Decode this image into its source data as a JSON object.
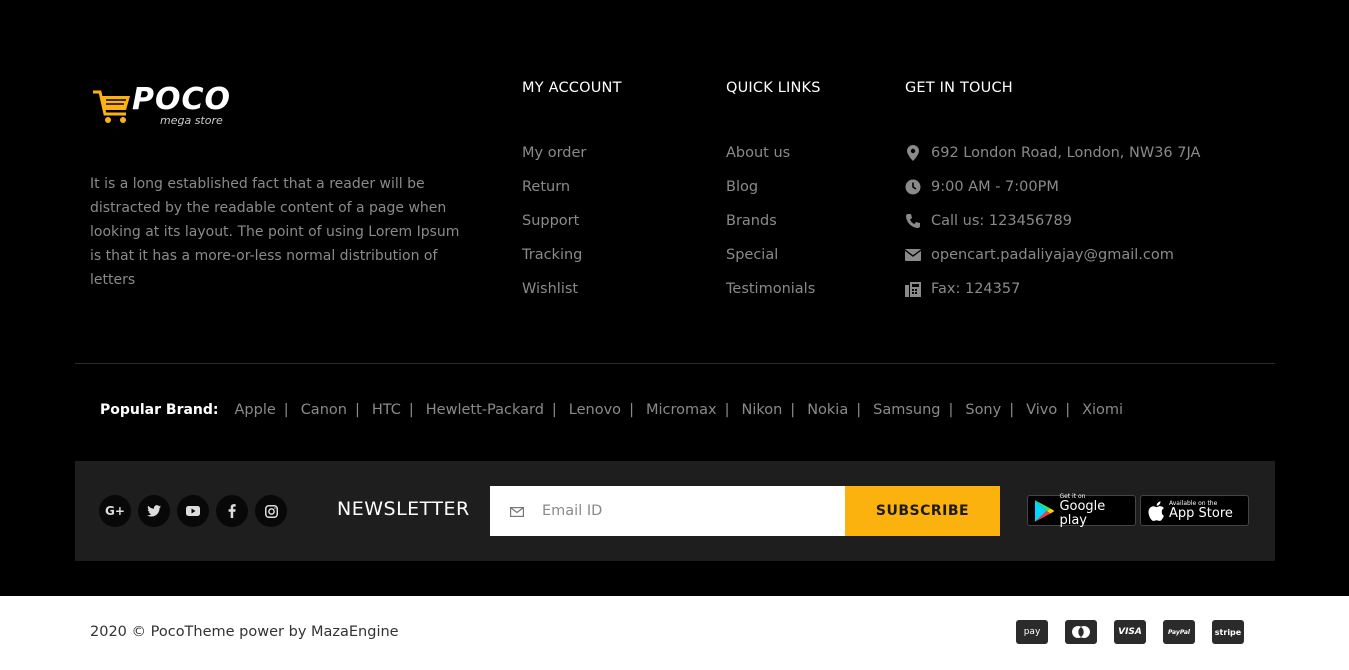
{
  "logo": {
    "name": "POCO",
    "tagline": "mega store"
  },
  "about": "It is a long established fact that a reader will be distracted by the readable content of a page when looking at its layout. The point of using Lorem Ipsum is that it has a more-or-less normal distribution of letters",
  "my_account": {
    "title": "MY ACCOUNT",
    "links": [
      "My order",
      "Return",
      "Support",
      "Tracking",
      "Wishlist"
    ]
  },
  "quick_links": {
    "title": "QUICK LINKS",
    "links": [
      "About us",
      "Blog",
      "Brands",
      "Special",
      "Testimonials"
    ]
  },
  "get_in_touch": {
    "title": "GET IN TOUCH",
    "items": [
      {
        "icon": "map-marker-icon",
        "text": "692 London Road, London, NW36 7JA"
      },
      {
        "icon": "clock-icon",
        "text": "9:00 AM - 7:00PM"
      },
      {
        "icon": "phone-icon",
        "text": "Call us: 123456789"
      },
      {
        "icon": "envelope-icon",
        "text": "opencart.padaliyajay@gmail.com"
      },
      {
        "icon": "fax-icon",
        "text": "Fax: 124357"
      }
    ]
  },
  "popular_brand": {
    "label": "Popular Brand:",
    "brands": [
      "Apple",
      "Canon",
      "HTC",
      "Hewlett-Packard",
      "Lenovo",
      "Micromax",
      "Nikon",
      "Nokia",
      "Samsung",
      "Sony",
      "Vivo",
      "Xiomi"
    ],
    "separator": "|"
  },
  "social": [
    "google-plus-icon",
    "twitter-icon",
    "youtube-icon",
    "facebook-icon",
    "instagram-icon"
  ],
  "newsletter": {
    "title": "NEWSLETTER",
    "placeholder": "Email ID",
    "button": "SUBSCRIBE"
  },
  "app_stores": {
    "google_small": "Get it on",
    "google_big": "Google play",
    "apple_small": "Available on the",
    "apple_big": "App Store"
  },
  "copyright": "2020 © PocoTheme power by MazaEngine",
  "payments": [
    {
      "icon": "amazon-pay-icon",
      "label": "pay"
    },
    {
      "icon": "mastercard-icon",
      "label": ""
    },
    {
      "icon": "visa-icon",
      "label": "VISA"
    },
    {
      "icon": "paypal-icon",
      "label": "PayPal"
    },
    {
      "icon": "stripe-icon",
      "label": "stripe"
    }
  ],
  "colors": {
    "accent": "#fbb20f",
    "background": "#000000",
    "bar": "#1e1e1e",
    "text_muted": "#8a8a8a"
  }
}
